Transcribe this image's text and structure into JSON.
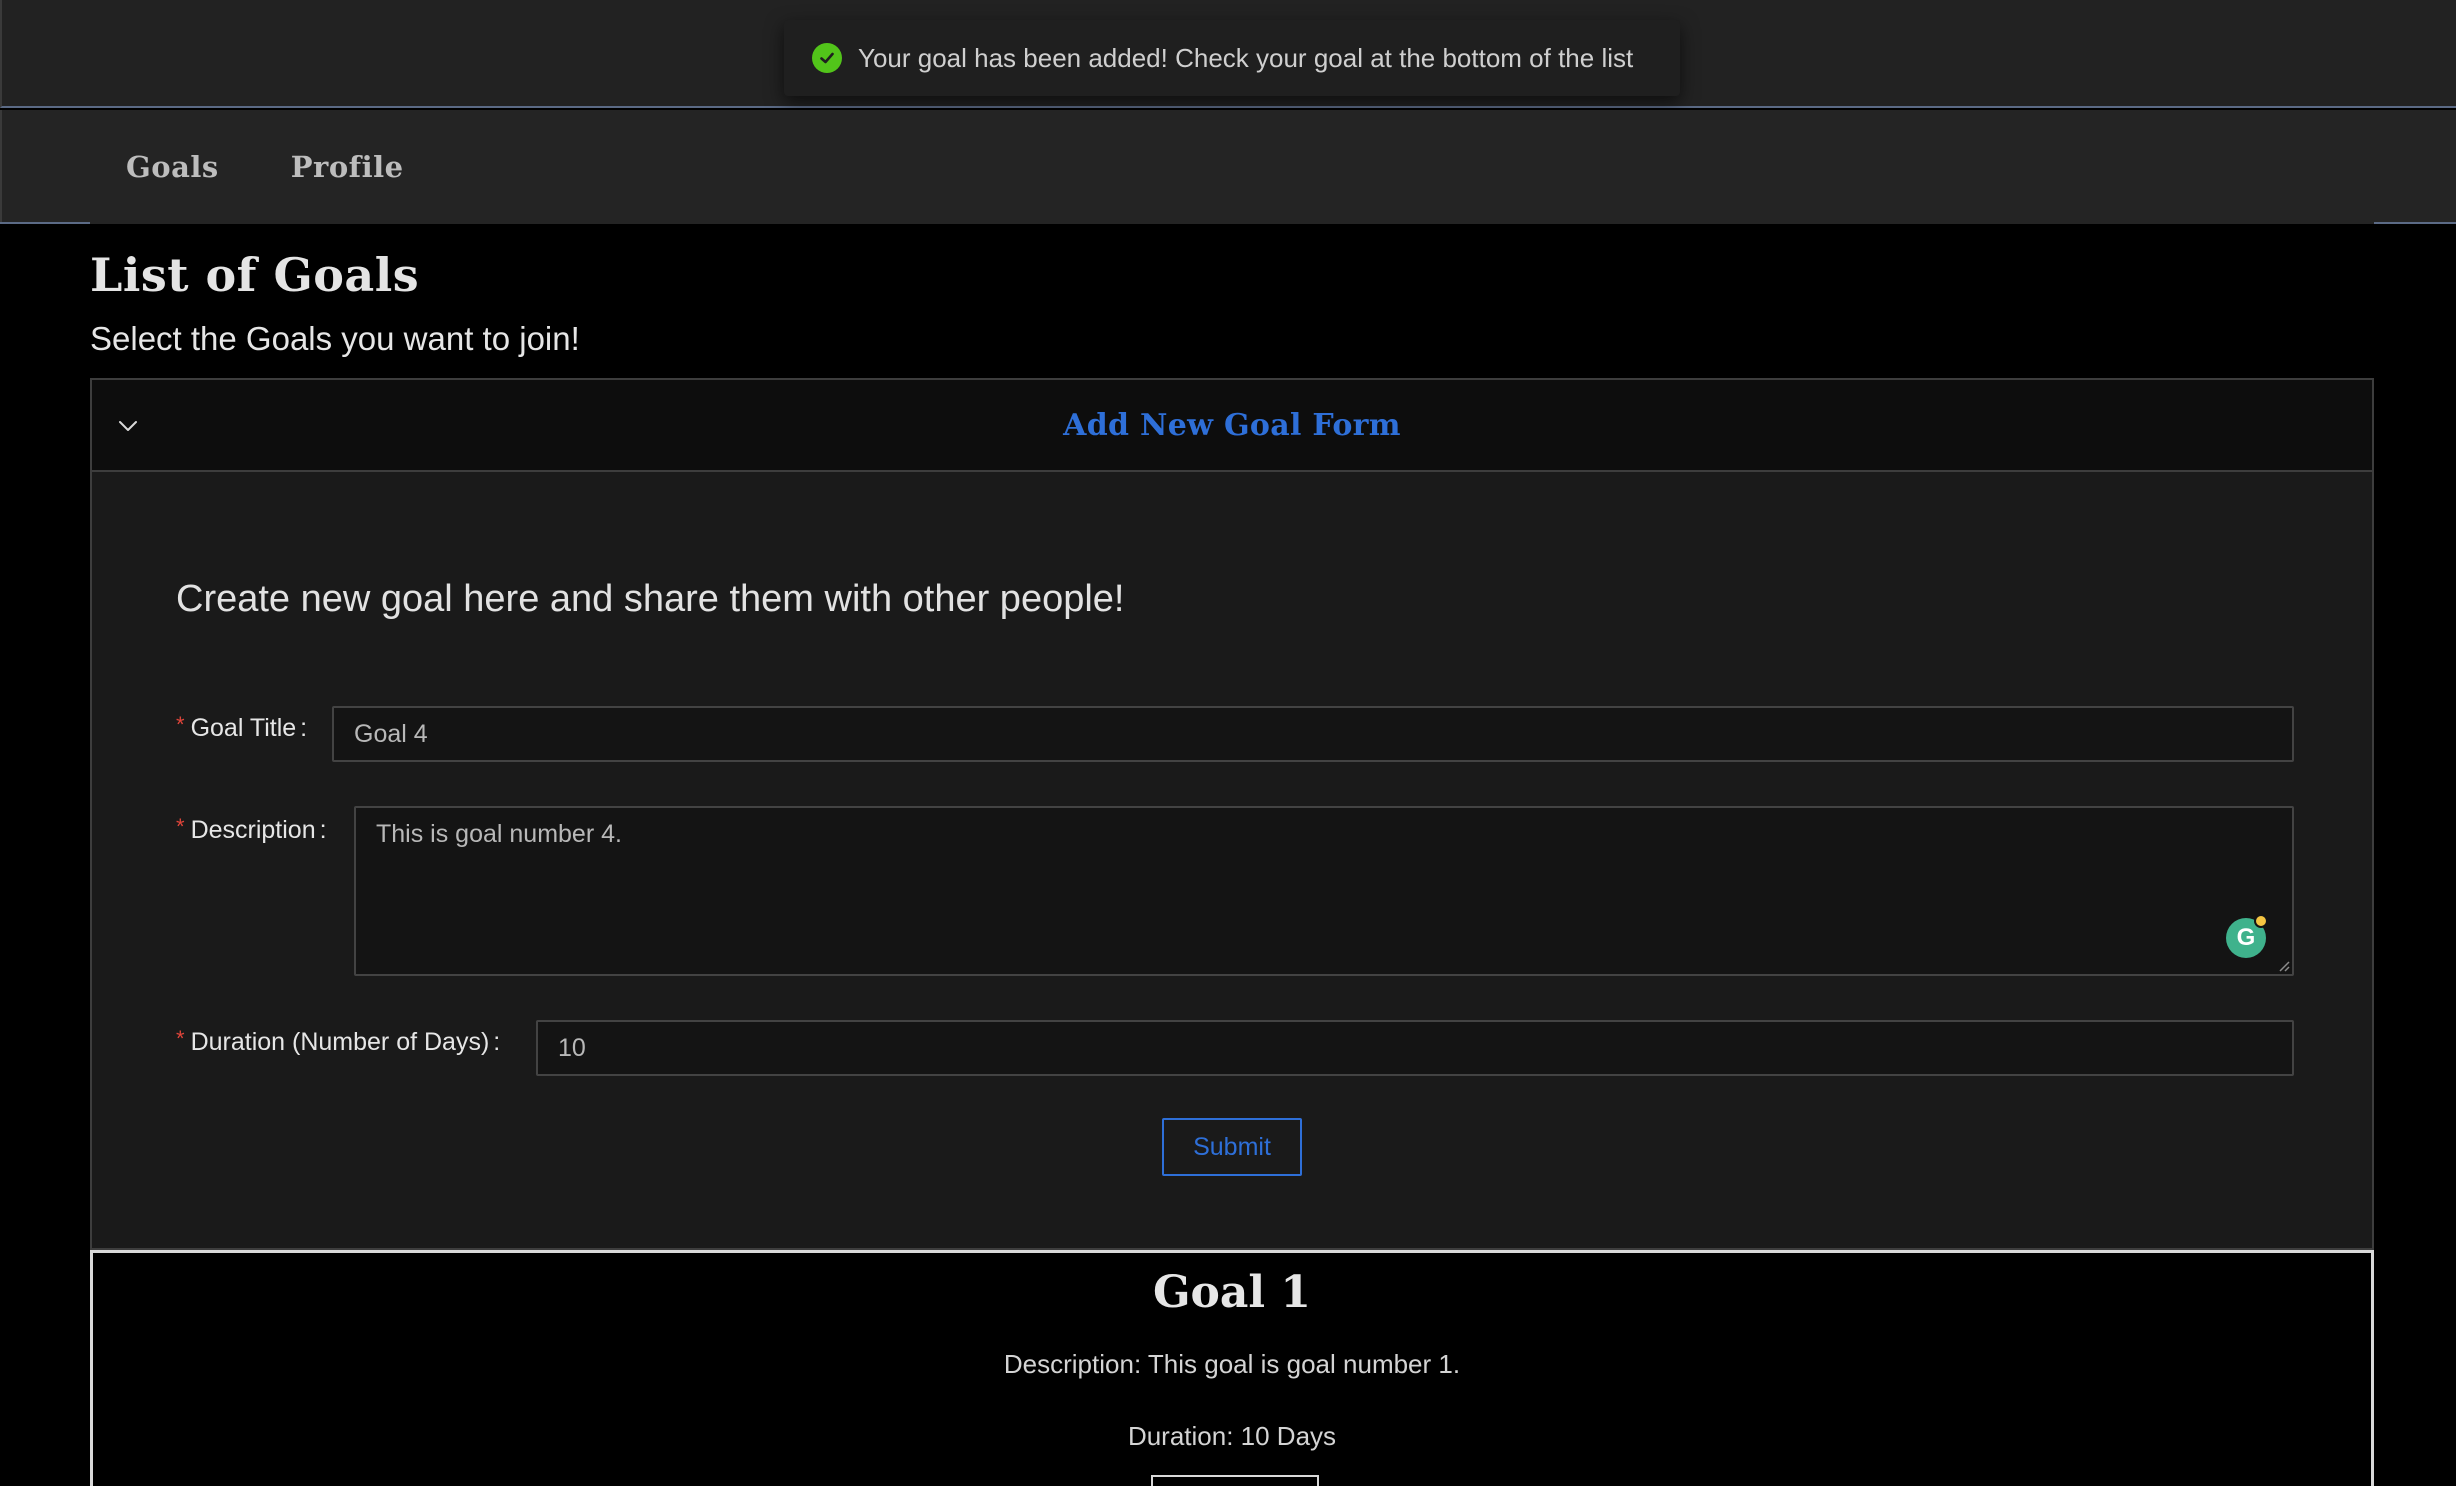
{
  "toast": {
    "message": "Your goal has been added! Check your goal at the bottom of the list",
    "icon": "check-circle-icon",
    "color": "#52c41a"
  },
  "nav": {
    "items": [
      {
        "label": "Goals"
      },
      {
        "label": "Profile"
      }
    ]
  },
  "page": {
    "title": "List of Goals",
    "subtitle": "Select the Goals you want to join!"
  },
  "panel": {
    "title": "Add New Goal Form",
    "title_color": "#2e6fd8",
    "expanded": true,
    "form": {
      "heading": "Create new goal here and share them with other people!",
      "required_mark": "*",
      "fields": {
        "title": {
          "label": "Goal Title",
          "value": "Goal 4"
        },
        "description": {
          "label": "Description",
          "value": "This is goal number 4."
        },
        "duration": {
          "label": "Duration (Number of Days)",
          "value": "10"
        }
      },
      "colon": ":",
      "submit_label": "Submit",
      "grammarly_letter": "G"
    }
  },
  "goals": [
    {
      "title": "Goal 1",
      "description": "Description: This goal is goal number 1.",
      "duration": "Duration: 10 Days"
    }
  ]
}
